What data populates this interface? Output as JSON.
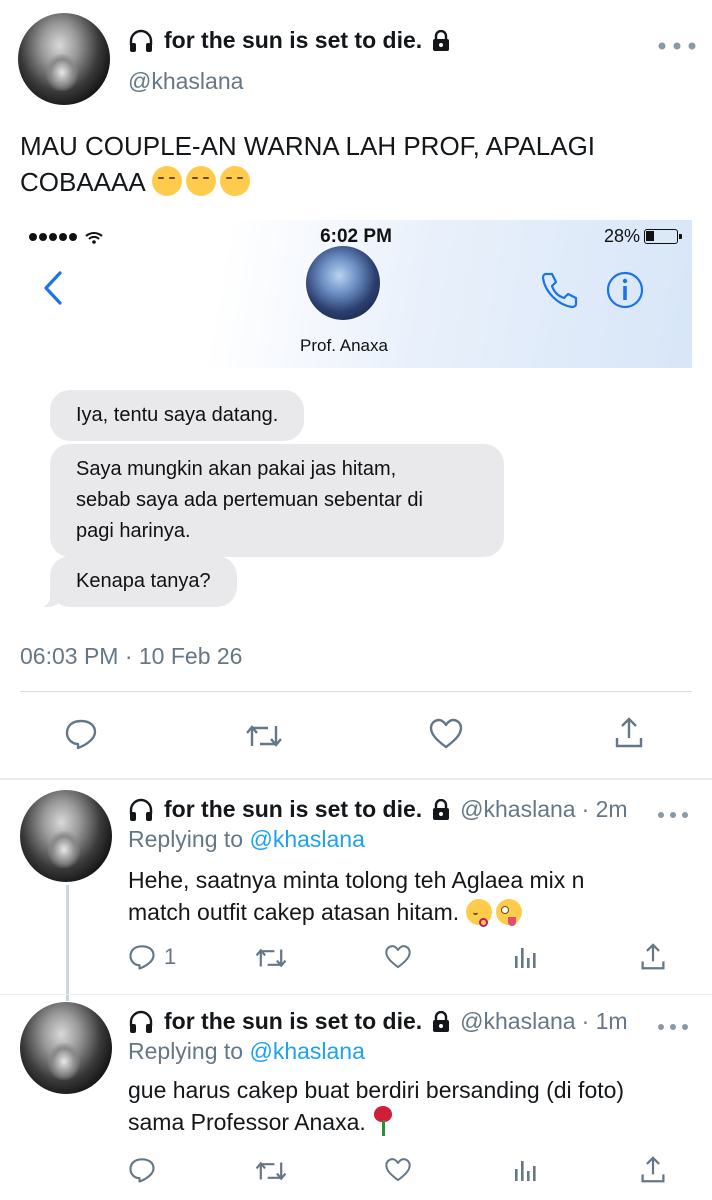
{
  "tweet": {
    "display_name": "for the sun is set to die.",
    "handle": "@khaslana",
    "text": "MAU COUPLE-AN WARNA LAH PROF, APALAGI COBAAAA",
    "text_line1": "MAU COUPLE-AN WARNA LAH PROF, APALAGI",
    "text_line2": "COBAAAA",
    "emojis": [
      "pensive",
      "pensive",
      "pensive"
    ],
    "timestamp": "06:03 PM · 10 Feb 26"
  },
  "embedded_screenshot": {
    "time": "6:02 PM",
    "battery": "28%",
    "contact_name": "Prof. Anaxa",
    "messages": [
      {
        "lines": [
          "Iya, tentu saya datang."
        ]
      },
      {
        "lines": [
          "Saya mungkin akan pakai jas hitam,",
          "sebab saya ada pertemuan sebentar di",
          "pagi harinya."
        ]
      },
      {
        "lines": [
          "Kenapa tanya?"
        ]
      }
    ]
  },
  "replies": [
    {
      "display_name": "for the sun is set to die.",
      "handle": "@khaslana",
      "time": "· 2m",
      "replying_to_label": "Replying to",
      "replying_to": "@khaslana",
      "text_line1": "Hehe, saatnya minta tolong teh Aglaea mix n",
      "text_line2": "match outfit cakep atasan hitam.",
      "emojis": [
        "kissing-face",
        "zany-face"
      ],
      "reply_count": "1"
    },
    {
      "display_name": "for the sun is set to die.",
      "handle": "@khaslana",
      "time": "· 1m",
      "replying_to_label": "Replying to",
      "replying_to": "@khaslana",
      "text_line1": "gue harus cakep buat berdiri bersanding (di foto)",
      "text_line2": "sama Professor Anaxa.",
      "emojis": [
        "rose"
      ],
      "reply_count": ""
    }
  ],
  "colors": {
    "link": "#1da1f2",
    "muted": "#657786",
    "ios_blue": "#1a73e8",
    "bubble_gray": "#e9e9eb"
  },
  "icons": [
    "headphones-icon",
    "lock-icon",
    "more-icon",
    "reply-icon",
    "retweet-icon",
    "like-icon",
    "share-icon",
    "analytics-icon",
    "back-chevron-icon",
    "phone-icon",
    "info-icon",
    "signal-dots-icon",
    "wifi-icon",
    "battery-icon"
  ]
}
